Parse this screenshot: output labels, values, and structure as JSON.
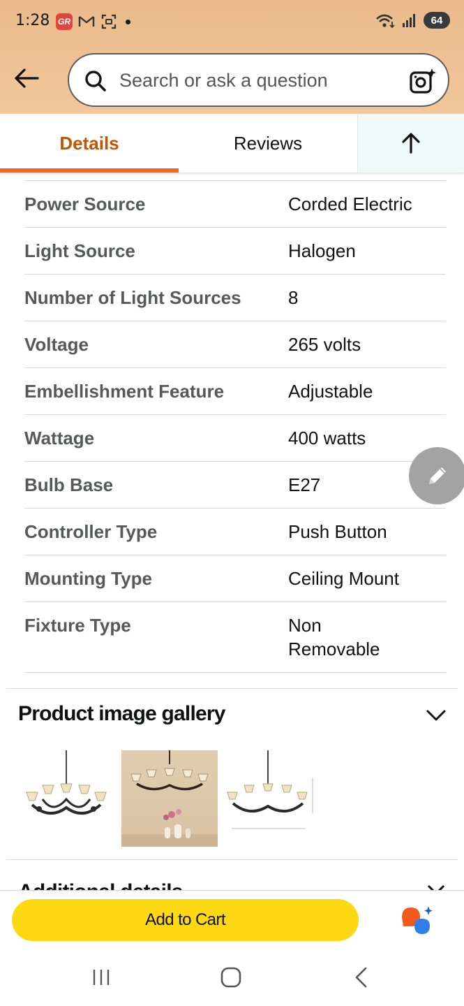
{
  "status_bar": {
    "time": "1:28",
    "battery": "64",
    "icons": [
      "app-badge-icon",
      "gmail-icon",
      "screenshot-icon",
      "wifi-icon",
      "signal-icon"
    ],
    "app_badge_text": "GR"
  },
  "header": {
    "search_placeholder": "Search or ask a question",
    "back_icon": "arrow-left-icon",
    "camera_icon": "camera-sparkle-icon"
  },
  "tabs": {
    "details": "Details",
    "reviews": "Reviews",
    "up_icon": "arrow-up-icon"
  },
  "specs": [
    {
      "label": "Power Source",
      "value": "Corded Electric"
    },
    {
      "label": "Light Source",
      "value": "Halogen"
    },
    {
      "label": "Number of Light Sources",
      "value": "8"
    },
    {
      "label": "Voltage",
      "value": "265 volts"
    },
    {
      "label": "Embellishment Feature",
      "value": "Adjustable"
    },
    {
      "label": "Wattage",
      "value": "400 watts"
    },
    {
      "label": "Bulb Base",
      "value": "E27"
    },
    {
      "label": "Controller Type",
      "value": "Push Button"
    },
    {
      "label": "Mounting Type",
      "value": "Ceiling Mount"
    },
    {
      "label": "Fixture Type",
      "value": "Non Removable"
    }
  ],
  "gallery": {
    "title": "Product image gallery",
    "thumbnail_count": 3
  },
  "additional": {
    "title": "Additional details"
  },
  "bottom": {
    "add_to_cart": "Add to Cart"
  },
  "colors": {
    "accent_orange": "#c45500",
    "tab_underline": "#e8692b",
    "cart_yellow": "#ffd814",
    "header_bg": "#efc295"
  }
}
